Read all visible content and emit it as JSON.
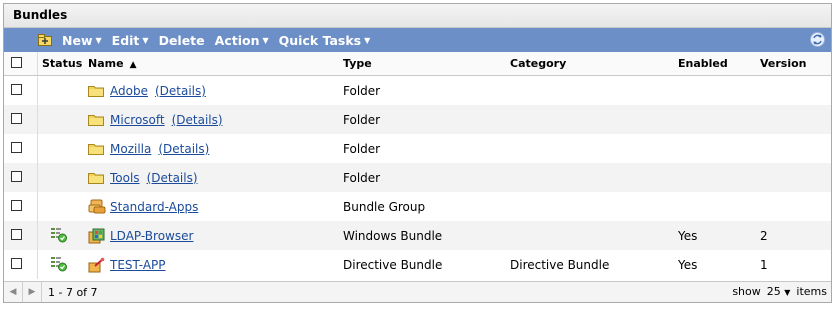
{
  "panel": {
    "title": "Bundles"
  },
  "toolbar": {
    "new_label": "New",
    "edit_label": "Edit",
    "delete_label": "Delete",
    "action_label": "Action",
    "quick_tasks_label": "Quick Tasks",
    "new_icon": "new-folder-icon",
    "refresh_icon": "refresh-icon"
  },
  "columns": {
    "status": "Status",
    "name": "Name",
    "type": "Type",
    "category": "Category",
    "enabled": "Enabled",
    "version": "Version"
  },
  "rows": [
    {
      "name": "Adobe",
      "details": "(Details)",
      "type": "Folder",
      "category": "",
      "enabled": "",
      "version": "",
      "icon": "folder-icon",
      "status": ""
    },
    {
      "name": "Microsoft",
      "details": "(Details)",
      "type": "Folder",
      "category": "",
      "enabled": "",
      "version": "",
      "icon": "folder-icon",
      "status": ""
    },
    {
      "name": "Mozilla",
      "details": "(Details)",
      "type": "Folder",
      "category": "",
      "enabled": "",
      "version": "",
      "icon": "folder-icon",
      "status": ""
    },
    {
      "name": "Tools",
      "details": "(Details)",
      "type": "Folder",
      "category": "",
      "enabled": "",
      "version": "",
      "icon": "folder-icon",
      "status": ""
    },
    {
      "name": "Standard-Apps",
      "details": "",
      "type": "Bundle Group",
      "category": "",
      "enabled": "",
      "version": "",
      "icon": "bundle-group-icon",
      "status": ""
    },
    {
      "name": "LDAP-Browser",
      "details": "",
      "type": "Windows Bundle",
      "category": "",
      "enabled": "Yes",
      "version": "2",
      "icon": "windows-bundle-icon",
      "status": "status-ok-icon"
    },
    {
      "name": "TEST-APP",
      "details": "",
      "type": "Directive Bundle",
      "category": "Directive Bundle",
      "enabled": "Yes",
      "version": "1",
      "icon": "directive-bundle-icon",
      "status": "status-ok-icon"
    }
  ],
  "footer": {
    "range": "1 - 7 of 7",
    "show_label": "show",
    "page_size": "25",
    "items_label": "items"
  },
  "colors": {
    "toolbar": "#6d8fc7",
    "link": "#1b4b9b",
    "folder": "#f3d25a"
  }
}
